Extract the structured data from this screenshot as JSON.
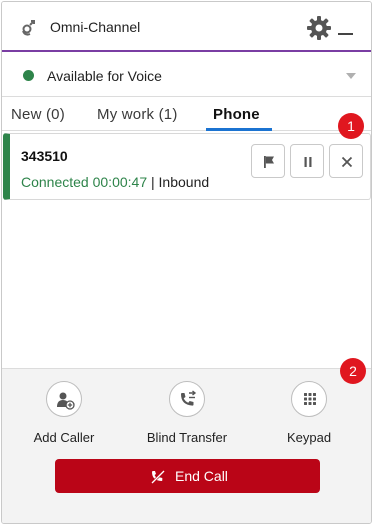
{
  "header": {
    "title": "Omni-Channel",
    "icon": "omni-channel-icon"
  },
  "status": {
    "label": "Available for Voice",
    "color": "#2e844a"
  },
  "tabs": [
    {
      "label": "New (0)"
    },
    {
      "label": "My work (1)"
    },
    {
      "label": "Phone",
      "active": true
    }
  ],
  "badges": [
    "1",
    "2"
  ],
  "work_item": {
    "number": "343510",
    "status": "Connected",
    "duration": "00:00:47",
    "separator": "|",
    "direction": "Inbound",
    "accent": "#2e844a",
    "actions": [
      "flag-icon",
      "pause-icon",
      "close-icon"
    ]
  },
  "footer": {
    "actions": [
      {
        "label": "Add Caller",
        "icon": "add-caller-icon"
      },
      {
        "label": "Blind Transfer",
        "icon": "transfer-icon"
      },
      {
        "label": "Keypad",
        "icon": "keypad-icon"
      }
    ],
    "end_call": {
      "label": "End Call",
      "color": "#ba0517"
    }
  }
}
